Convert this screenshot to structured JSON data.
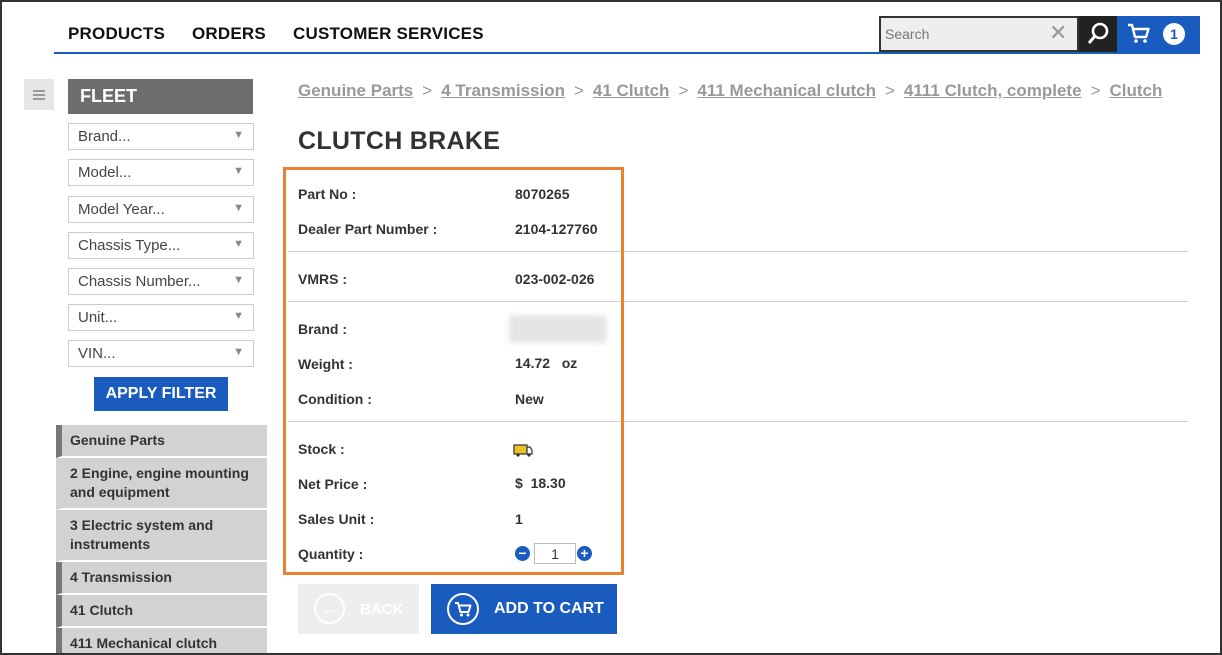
{
  "nav": {
    "products": "PRODUCTS",
    "orders": "ORDERS",
    "customer_services": "CUSTOMER SERVICES"
  },
  "search": {
    "placeholder": "Search"
  },
  "cart": {
    "count": "1"
  },
  "sidebar": {
    "heading": "FLEET",
    "filters": [
      "Brand...",
      "Model...",
      "Model Year...",
      "Chassis Type...",
      "Chassis Number...",
      "Unit...",
      "VIN..."
    ],
    "apply_label": "APPLY FILTER",
    "categories": [
      "Genuine Parts",
      "2 Engine, engine mounting and equipment",
      "3 Electric system and instruments",
      "4 Transmission",
      "41 Clutch",
      "411 Mechanical clutch"
    ]
  },
  "breadcrumb": [
    "Genuine Parts",
    "4 Transmission",
    "41 Clutch",
    "411 Mechanical clutch",
    "4111 Clutch, complete",
    "Clutch"
  ],
  "breadcrumb_separator": ">",
  "product": {
    "title": "CLUTCH BRAKE",
    "part_no_label": "Part No :",
    "part_no": "8070265",
    "dealer_label": "Dealer Part Number :",
    "dealer_part": "2104-127760",
    "vmrs_label": "VMRS :",
    "vmrs": "023-002-026",
    "brand_label": "Brand :",
    "weight_label": "Weight :",
    "weight": "14.72   oz",
    "condition_label": "Condition :",
    "condition": "New",
    "stock_label": "Stock :",
    "net_price_label": "Net Price :",
    "net_price": "$  18.30",
    "sales_unit_label": "Sales Unit :",
    "sales_unit": "1",
    "quantity_label": "Quantity :",
    "quantity": "1"
  },
  "actions": {
    "back": "BACK",
    "add_to_cart": "ADD TO CART"
  },
  "colors": {
    "accent": "#1a5bbf",
    "highlight": "#e8822e",
    "stock": "#e8c32a"
  }
}
